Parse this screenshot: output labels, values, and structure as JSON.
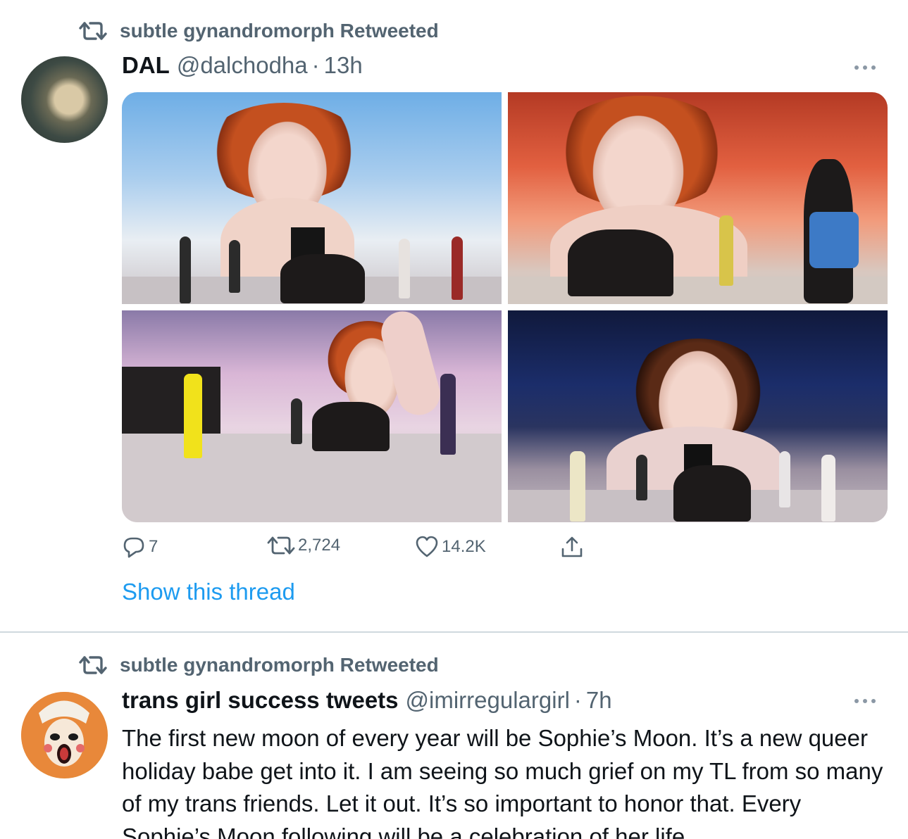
{
  "tweets": [
    {
      "retweeted_by": "subtle gynandromorph Retweeted",
      "author_name": "DAL",
      "handle": "@dalchodha",
      "separator": "·",
      "time": "13h",
      "actions": {
        "replies": "7",
        "retweets": "2,724",
        "likes": "14.2K"
      },
      "show_thread": "Show this thread"
    },
    {
      "retweeted_by": "subtle gynandromorph Retweeted",
      "author_name": "trans girl success tweets",
      "handle": "@imirregulargirl",
      "separator": "·",
      "time": "7h",
      "text": "The first new moon of every year will be Sophie’s Moon. It’s a new queer holiday babe get into it. I am seeing so much grief on my TL from so many of my trans friends. Let it out. It’s so important to honor that. Every Sophie’s Moon following will be a celebration of her life"
    }
  ],
  "icons": [
    "retweet-icon",
    "reply-icon",
    "like-icon",
    "share-icon",
    "more-icon"
  ],
  "colors": {
    "secondary_text": "#536471",
    "link": "#1d9bf0",
    "divider": "#cfd9de"
  }
}
